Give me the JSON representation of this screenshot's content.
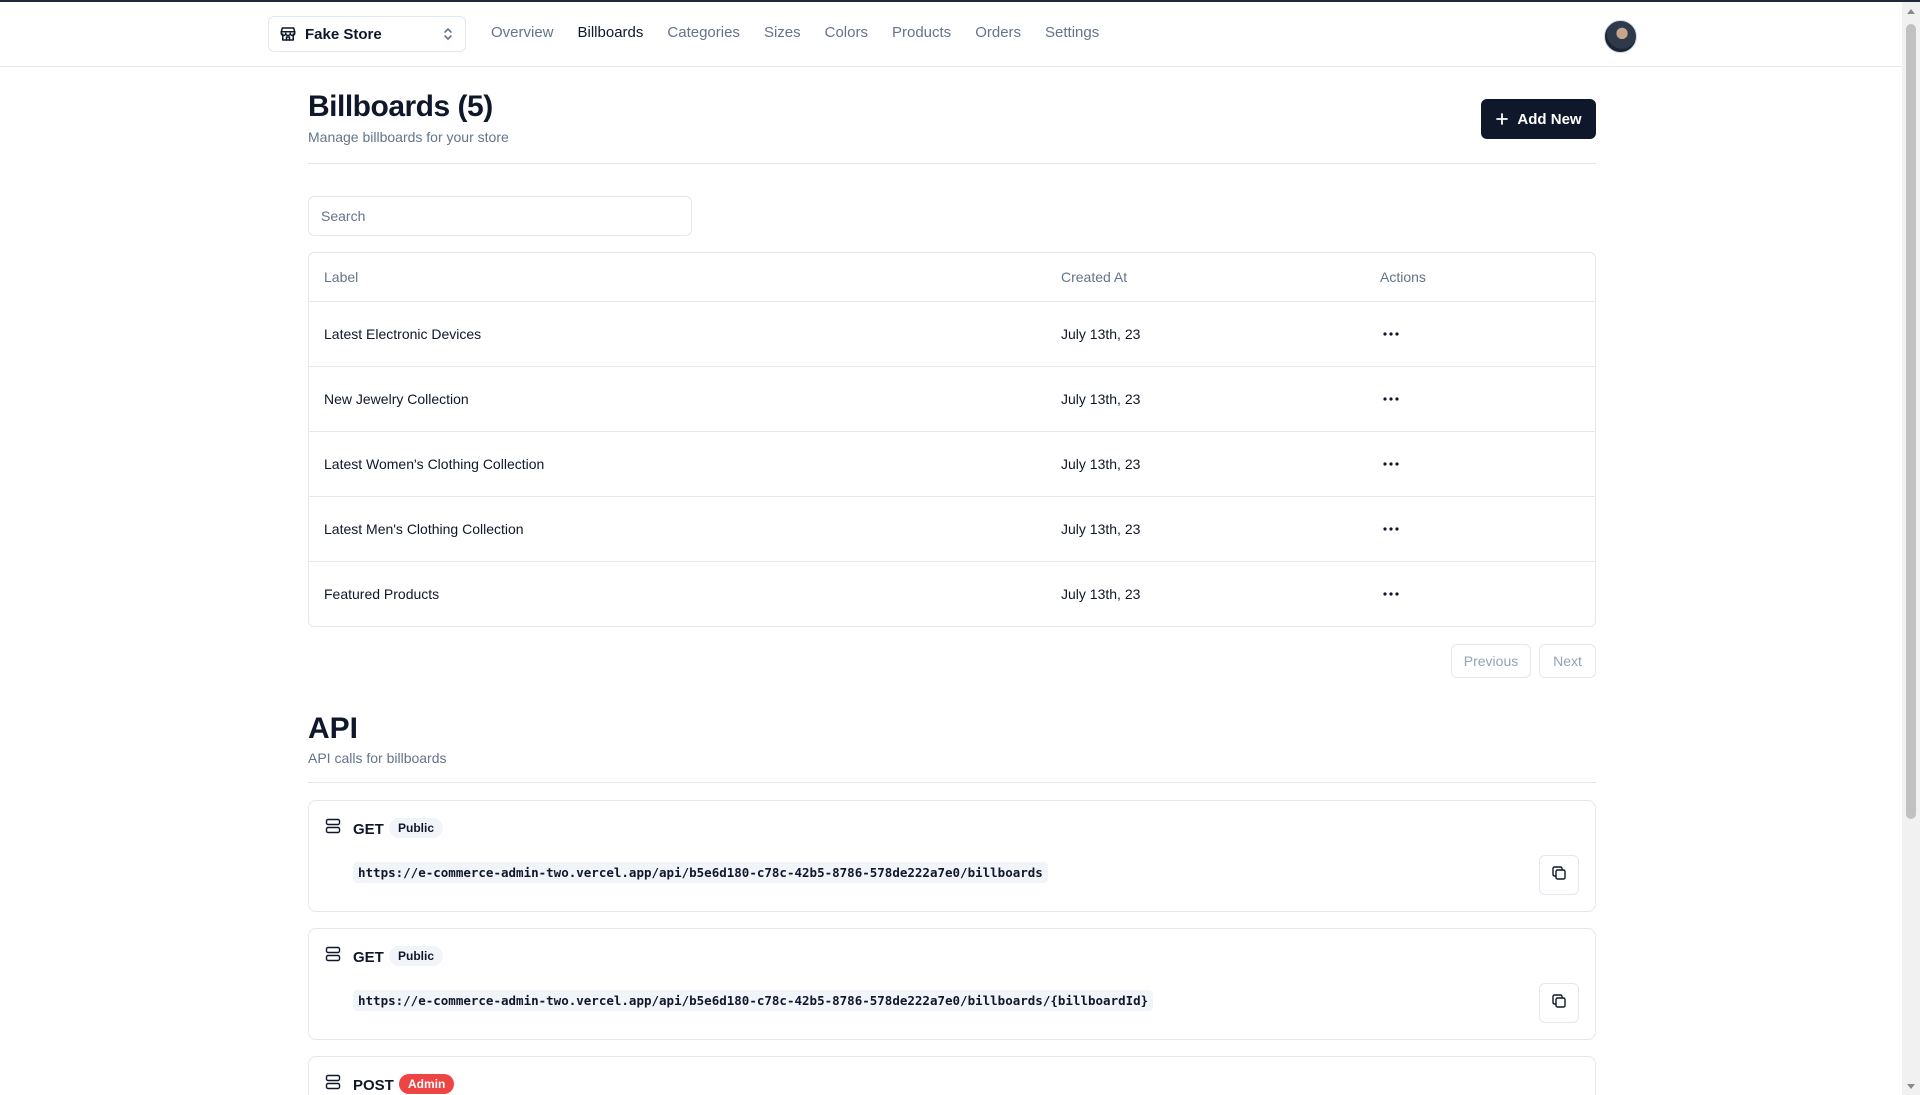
{
  "navbar": {
    "store_name": "Fake Store",
    "links": [
      {
        "label": "Overview",
        "active": false
      },
      {
        "label": "Billboards",
        "active": true
      },
      {
        "label": "Categories",
        "active": false
      },
      {
        "label": "Sizes",
        "active": false
      },
      {
        "label": "Colors",
        "active": false
      },
      {
        "label": "Products",
        "active": false
      },
      {
        "label": "Orders",
        "active": false
      },
      {
        "label": "Settings",
        "active": false
      }
    ]
  },
  "header": {
    "title": "Billboards (5)",
    "subtitle": "Manage billboards for your store",
    "add_label": "Add New"
  },
  "search": {
    "placeholder": "Search",
    "value": ""
  },
  "table": {
    "columns": {
      "label": "Label",
      "created_at": "Created At",
      "actions": "Actions"
    },
    "rows": [
      {
        "label": "Latest Electronic Devices",
        "created_at": "July 13th, 23"
      },
      {
        "label": "New Jewelry Collection",
        "created_at": "July 13th, 23"
      },
      {
        "label": "Latest Women's Clothing Collection",
        "created_at": "July 13th, 23"
      },
      {
        "label": "Latest Men's Clothing Collection",
        "created_at": "July 13th, 23"
      },
      {
        "label": "Featured Products",
        "created_at": "July 13th, 23"
      }
    ]
  },
  "pagination": {
    "previous_label": "Previous",
    "next_label": "Next"
  },
  "api": {
    "title": "API",
    "subtitle": "API calls for billboards",
    "cards": [
      {
        "method": "GET",
        "badge": "Public",
        "badge_variant": "public",
        "url": "https://e-commerce-admin-two.vercel.app/api/b5e6d180-c78c-42b5-8786-578de222a7e0/billboards"
      },
      {
        "method": "GET",
        "badge": "Public",
        "badge_variant": "public",
        "url": "https://e-commerce-admin-two.vercel.app/api/b5e6d180-c78c-42b5-8786-578de222a7e0/billboards/{billboardId}"
      },
      {
        "method": "POST",
        "badge": "Admin",
        "badge_variant": "admin",
        "url": ""
      }
    ]
  },
  "colors": {
    "primary": "#0f172a",
    "muted": "#64748b",
    "border": "#e5e7eb",
    "admin_badge": "#ef4444"
  },
  "icons": {
    "store": "store-icon",
    "switcher": "chevrons-up-down-icon",
    "add": "plus-icon",
    "row_actions": "more-horizontal-icon",
    "api": "server-icon",
    "copy": "copy-icon"
  }
}
